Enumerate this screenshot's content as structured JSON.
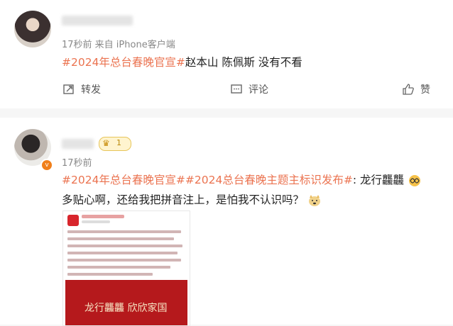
{
  "post1": {
    "meta": "17秒前   来自 iPhone客户端",
    "hashtag": "#2024年总台春晚官宣#",
    "text": "赵本山 陈佩斯 没有不看",
    "actions": {
      "repost": "转发",
      "comment": "评论",
      "like": "赞"
    }
  },
  "post2": {
    "level": "1",
    "meta": "17秒前",
    "hashtag1": "#2024年总台春晚官宣#",
    "hashtag2": "#2024总台春晚主题主标识发布#",
    "text1_tail": ": 龙行龘龘",
    "text2": "多贴心啊，还给我把拼音注上，是怕我不认识吗？",
    "image_caption": "龙行龘龘 欣欣家国"
  },
  "colors": {
    "hashtag": "#eb7350",
    "meta": "#888888",
    "badge": "#f07f1a"
  }
}
